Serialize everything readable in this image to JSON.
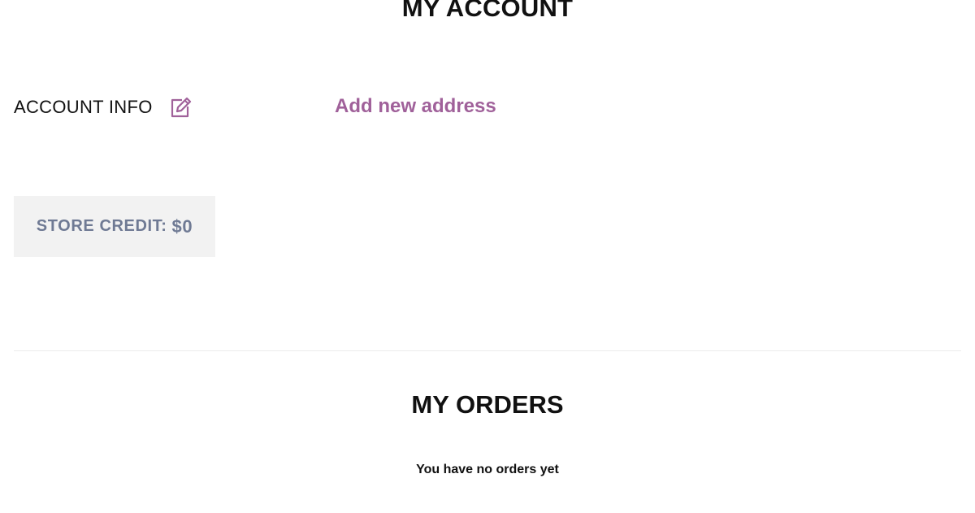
{
  "header": {
    "title": "MY ACCOUNT"
  },
  "account_info": {
    "title": "ACCOUNT INFO",
    "edit_icon": "edit-icon"
  },
  "address": {
    "add_label": "Add new address"
  },
  "store_credit": {
    "label": "STORE CREDIT:",
    "amount": "$0"
  },
  "orders": {
    "title": "MY ORDERS",
    "empty_message": "You have no orders yet"
  },
  "colors": {
    "accent": "#a0619a",
    "credit_text": "#6f7a94",
    "credit_bg": "#f2f2f2"
  }
}
